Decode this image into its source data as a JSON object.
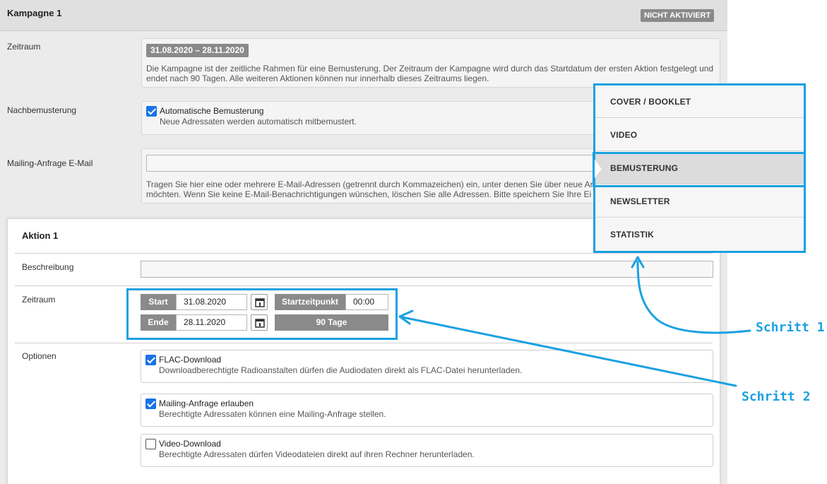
{
  "campaign": {
    "title": "Kampagne 1",
    "status": "NICHT AKTIVIERT",
    "zeitraum": {
      "label": "Zeitraum",
      "range": "31.08.2020 – 28.11.2020",
      "hint_line1": "Die Kampagne ist der zeitliche Rahmen für eine Bemusterung. Der Zeitraum der Kampagne wird durch das Startdatum der ersten Aktion festgelegt und",
      "hint_line2": "endet nach 90 Tagen. Alle weiteren Aktionen können nur innerhalb dieses Zeitraums liegen."
    },
    "nachbemusterung": {
      "label": "Nachbemusterung",
      "checkbox_label": "Automatische Bemusterung",
      "checked": true,
      "hint": "Neue Adressaten werden automatisch mitbemustert."
    },
    "mailing": {
      "label": "Mailing-Anfrage E-Mail",
      "value": "",
      "hint_line1": "Tragen Sie hier eine oder mehrere E-Mail-Adressen (getrennt durch Kommazeichen) ein, unter denen Sie über neue Ar",
      "hint_line2": "möchten. Wenn Sie keine E-Mail-Benachrichtigungen wünschen, löschen Sie alle Adressen. Bitte speichern Sie Ihre Ei"
    }
  },
  "aktion": {
    "title": "Aktion 1",
    "beschreibung": {
      "label": "Beschreibung",
      "value": ""
    },
    "zeitraum": {
      "label": "Zeitraum",
      "start_label": "Start",
      "start_date": "31.08.2020",
      "startzeit_label": "Startzeitpunkt",
      "startzeit_value": "00:00",
      "ende_label": "Ende",
      "ende_date": "28.11.2020",
      "duration": "90 Tage"
    },
    "optionen": {
      "label": "Optionen",
      "items": [
        {
          "label": "FLAC-Download",
          "checked": true,
          "hint": "Downloadberechtigte Radioanstalten dürfen die Audiodaten direkt als FLAC-Datei herunterladen."
        },
        {
          "label": "Mailing-Anfrage erlauben",
          "checked": true,
          "hint": "Berechtigte Adressaten können eine Mailing-Anfrage stellen."
        },
        {
          "label": "Video-Download",
          "checked": false,
          "hint": "Berechtigte Adressaten dürfen Videodateien direkt auf ihren Rechner herunterladen."
        }
      ]
    }
  },
  "menu": {
    "items": [
      {
        "label": "COVER / BOOKLET",
        "active": false
      },
      {
        "label": "VIDEO",
        "active": false
      },
      {
        "label": "BEMUSTERUNG",
        "active": true
      },
      {
        "label": "NEWSLETTER",
        "active": false
      },
      {
        "label": "STATISTIK",
        "active": false
      }
    ]
  },
  "annotations": {
    "step1": "Schritt 1",
    "step2": "Schritt 2",
    "color": "#1ba1e2"
  },
  "colors": {
    "checkbox": "#1a73e8",
    "badge": "#8a8a8a"
  }
}
